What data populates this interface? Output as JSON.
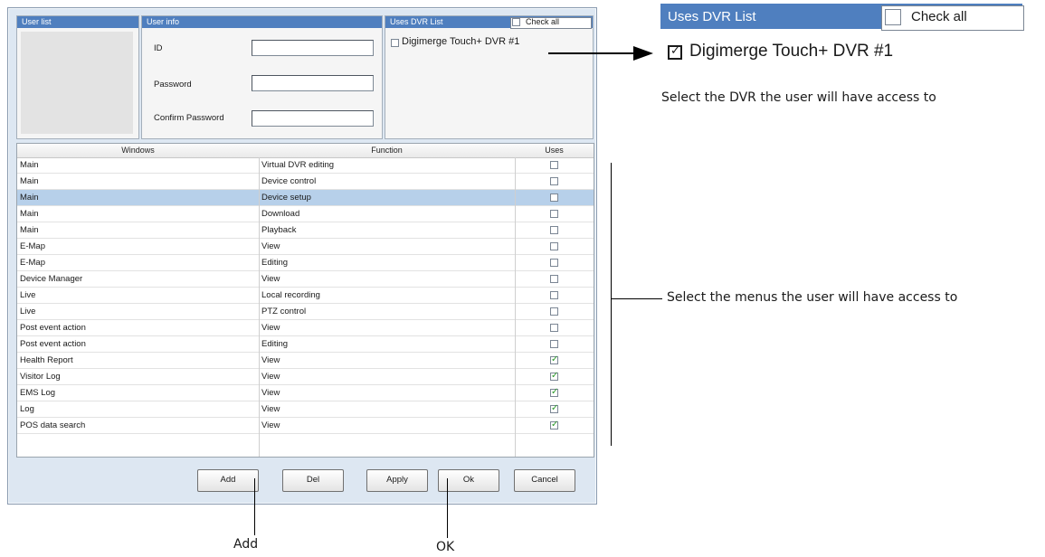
{
  "panels": {
    "user_list_title": "User list",
    "user_info_title": "User info",
    "dvr_list_title": "Uses DVR List",
    "check_all_label": "Check all"
  },
  "user_info": {
    "id_label": "ID",
    "password_label": "Password",
    "confirm_label": "Confirm Password",
    "id_value": "",
    "password_value": "",
    "confirm_value": ""
  },
  "dvr_list": {
    "items": [
      {
        "label": "Digimerge Touch+ DVR #1",
        "checked": false
      }
    ]
  },
  "table": {
    "headers": [
      "Windows",
      "Function",
      "Uses"
    ],
    "rows": [
      {
        "window": "Main",
        "function": "Virtual DVR editing",
        "uses": false
      },
      {
        "window": "Main",
        "function": "Device control",
        "uses": false
      },
      {
        "window": "Main",
        "function": "Device setup",
        "uses": false,
        "selected": true
      },
      {
        "window": "Main",
        "function": "Download",
        "uses": false
      },
      {
        "window": "Main",
        "function": "Playback",
        "uses": false
      },
      {
        "window": "E-Map",
        "function": "View",
        "uses": false
      },
      {
        "window": "E-Map",
        "function": "Editing",
        "uses": false
      },
      {
        "window": "Device Manager",
        "function": "View",
        "uses": false
      },
      {
        "window": "Live",
        "function": "Local recording",
        "uses": false
      },
      {
        "window": "Live",
        "function": "PTZ control",
        "uses": false
      },
      {
        "window": "Post event action",
        "function": "View",
        "uses": false
      },
      {
        "window": "Post event action",
        "function": "Editing",
        "uses": false
      },
      {
        "window": "Health Report",
        "function": "View",
        "uses": true
      },
      {
        "window": "Visitor Log",
        "function": "View",
        "uses": true
      },
      {
        "window": "EMS Log",
        "function": "View",
        "uses": true
      },
      {
        "window": "Log",
        "function": "View",
        "uses": true
      },
      {
        "window": "POS data search",
        "function": "View",
        "uses": true
      }
    ]
  },
  "buttons": {
    "add": "Add",
    "del": "Del",
    "apply": "Apply",
    "ok": "Ok",
    "cancel": "Cancel"
  },
  "zoom_inset": {
    "title": "Uses DVR List",
    "check_all": "Check all",
    "item": "Digimerge Touch+ DVR #1",
    "item_checked": true
  },
  "annotations": {
    "dvr_note": "Select the DVR the user will have access to",
    "menus_note": "Select the menus the user will have access to",
    "add_note": "Add",
    "ok_note": "OK"
  },
  "colors": {
    "panel_header": "#4f7fbf",
    "selected_row": "#b7d0ea",
    "check_green": "#2a9a28"
  }
}
